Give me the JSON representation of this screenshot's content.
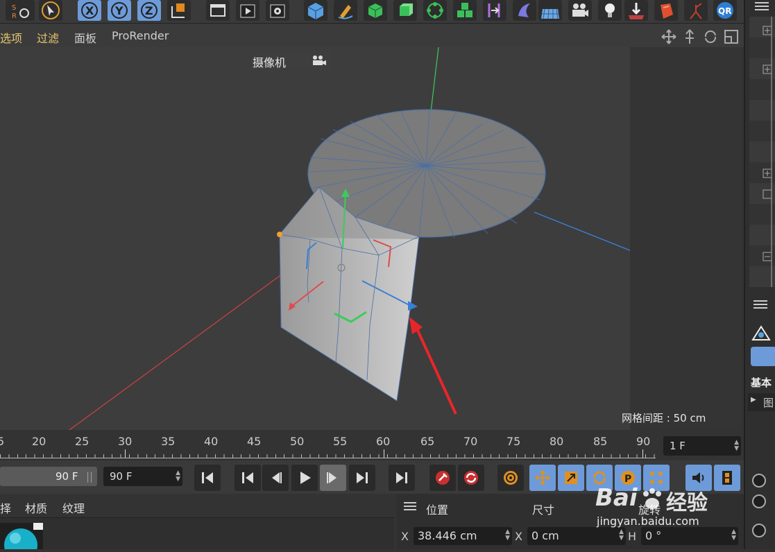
{
  "viewport_menu": {
    "items": [
      "选项",
      "过滤",
      "面板",
      "ProRender"
    ]
  },
  "viewport": {
    "camera_label": "摄像机",
    "grid_spacing": "网格间距 : 50 cm"
  },
  "timeline": {
    "ticks": [
      "5",
      "20",
      "25",
      "30",
      "35",
      "40",
      "45",
      "50",
      "55",
      "60",
      "65",
      "70",
      "75",
      "80",
      "85",
      "90"
    ],
    "current_frame": "1 F"
  },
  "transport": {
    "end_frame_left": "90 F",
    "end_frame_right": "90 F"
  },
  "material_panel": {
    "tabs": [
      "择",
      "材质",
      "纹理"
    ]
  },
  "coord_panel": {
    "headers": {
      "position": "位置",
      "size": "尺寸",
      "rotation": "旋转"
    },
    "x_label": "X",
    "x_position": "38.446 cm",
    "x_label2": "X",
    "x_size": "0 cm",
    "h_label": "H",
    "h_rotation": "0 °"
  },
  "right_panel": {
    "section_label": "基本",
    "sub_label": "图"
  },
  "watermark": {
    "brand": "Bai",
    "brand2": "经验",
    "url": "jingyan.baidu.com"
  },
  "colors": {
    "x_axis": "#d04040",
    "y_axis": "#3ccb5a",
    "z_axis": "#3a7fd6",
    "accent_blue": "#6d9bd9",
    "menu_yellow": "#e7c76f",
    "arrow_red": "#e8262a"
  }
}
